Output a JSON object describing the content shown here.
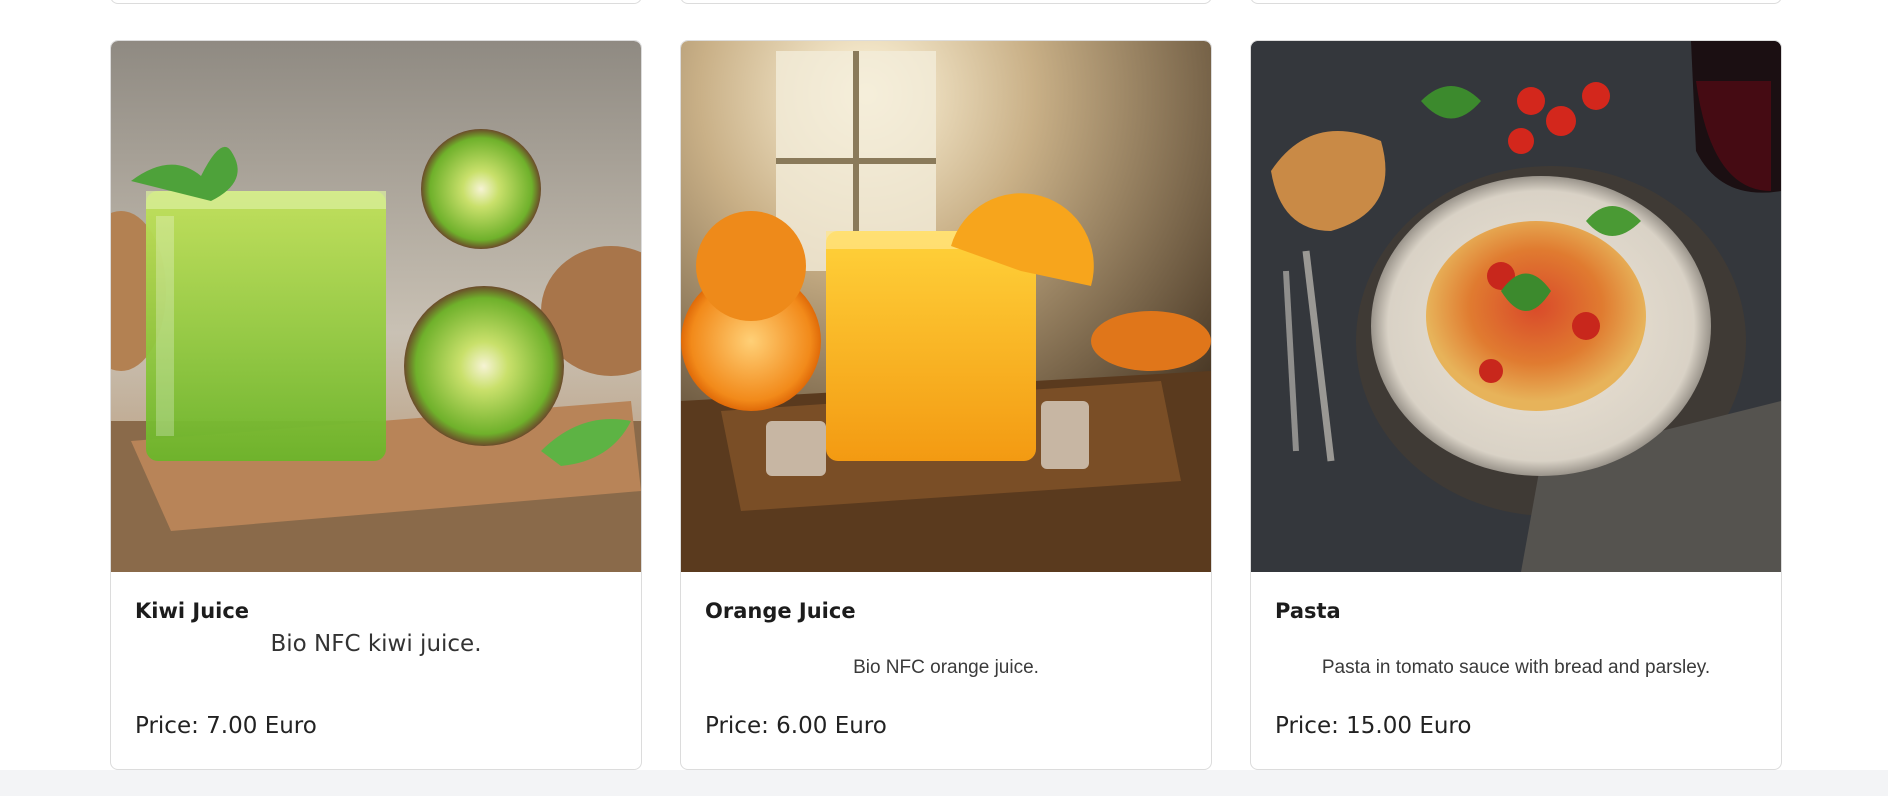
{
  "products": [
    {
      "name": "Kiwi Juice",
      "description": "Bio NFC kiwi juice.",
      "price": "Price: 7.00 Euro",
      "image": "kiwi-juice-photo"
    },
    {
      "name": "Orange Juice",
      "description": "Bio NFC orange juice.",
      "price": "Price: 6.00 Euro",
      "image": "orange-juice-photo"
    },
    {
      "name": "Pasta",
      "description": "Pasta in tomato sauce with bread and parsley.",
      "price": "Price: 15.00 Euro",
      "image": "pasta-photo"
    }
  ]
}
